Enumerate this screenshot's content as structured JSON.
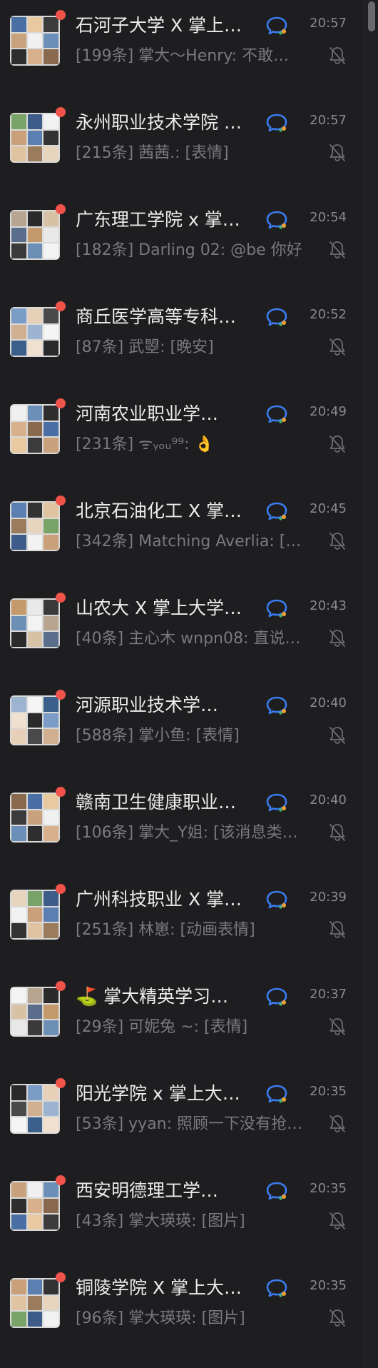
{
  "colors": {
    "background": "#1e1e20",
    "title_text": "#ececec",
    "secondary_text": "#7a7a7e",
    "unread_badge": "#f0534a",
    "chat_icon_blue": "#3b7cf0"
  },
  "icons": {
    "chat": "group-chat-icon",
    "mute": "bell-muted-icon",
    "badge": "unread-dot"
  },
  "conversations": [
    {
      "title": "石河子大学 X 掌上…",
      "time": "20:57",
      "preview": "[199条] 掌大～Henry: 不敢…"
    },
    {
      "title": "永州职业技术学院 …",
      "time": "20:57",
      "preview": "[215条] 茜茜.: [表情]"
    },
    {
      "title": "广东理工学院 x 掌…",
      "time": "20:54",
      "preview": "[182条] Darling 02: @be 你好"
    },
    {
      "title": "商丘医学高等专科…",
      "time": "20:52",
      "preview": "[87条] 武曌: [晚安]"
    },
    {
      "title": "河南农业职业学…",
      "time": "20:49",
      "preview": "[231条] ᯤᵧₒᵤ⁹⁹: 👌"
    },
    {
      "title": "北京石油化工 X 掌…",
      "time": "20:45",
      "preview": "[342条] Matching Averlia: […"
    },
    {
      "title": "山农大 X 掌上大学…",
      "time": "20:43",
      "preview": "[40条] 主心木 wnpn08: 直说…"
    },
    {
      "title": "河源职业技术学…",
      "time": "20:40",
      "preview": "[588条] 掌小鱼: [表情]"
    },
    {
      "title": "赣南卫生健康职业…",
      "time": "20:40",
      "preview": "[106条] 掌大_Y姐: [该消息类…"
    },
    {
      "title": "广州科技职业 X 掌…",
      "time": "20:39",
      "preview": "[251条] 林崽: [动画表情]"
    },
    {
      "title": "⛳ 掌大精英学习…",
      "time": "20:37",
      "preview": "[29条] 可妮兔 ~: [表情]"
    },
    {
      "title": "阳光学院 x 掌上大…",
      "time": "20:35",
      "preview": "[53条] yyan: 照顾一下没有抢…"
    },
    {
      "title": "西安明德理工学…",
      "time": "20:35",
      "preview": "[43条] 掌大瑛瑛: [图片]"
    },
    {
      "title": "铜陵学院 X 掌上大…",
      "time": "20:35",
      "preview": "[96条] 掌大瑛瑛: [图片]"
    }
  ]
}
